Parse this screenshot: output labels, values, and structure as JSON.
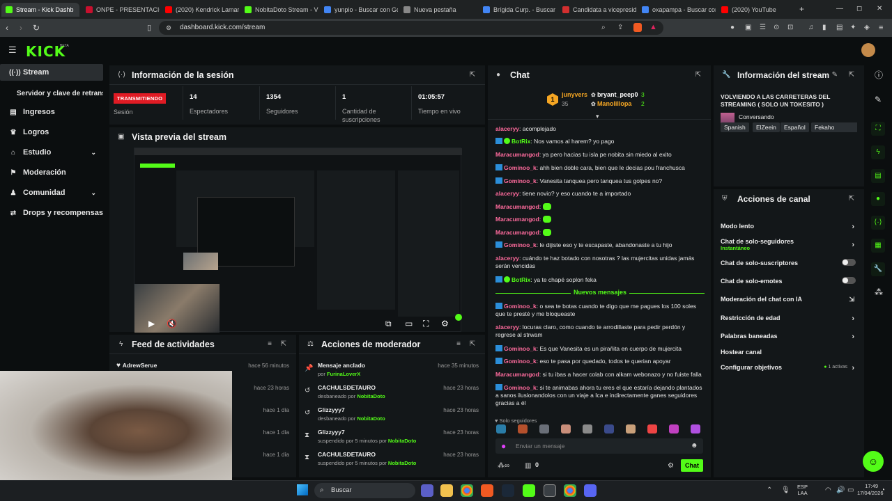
{
  "browser": {
    "tabs": [
      {
        "label": "Stream - Kick Dashb",
        "color": "#53fc18",
        "active": true
      },
      {
        "label": "ONPE - PRESENTACIÓ",
        "color": "#c8102e"
      },
      {
        "label": "(2020) Kendrick Lamar",
        "color": "#ff0000"
      },
      {
        "label": "NobitaDoto Stream - V",
        "color": "#53fc18"
      },
      {
        "label": "yunpio - Buscar con Go",
        "color": "#4285f4"
      },
      {
        "label": "Nueva pestaña",
        "color": "#888888"
      },
      {
        "label": "Brígida Curp. - Buscar",
        "color": "#4285f4"
      },
      {
        "label": "Candidata a vicepresid",
        "color": "#d32f2f"
      },
      {
        "label": "oxapampa - Buscar con",
        "color": "#4285f4"
      },
      {
        "label": "(2020) YouTube",
        "color": "#ff0000"
      }
    ],
    "url": "dashboard.kick.com/stream"
  },
  "app": {
    "logo": "KICK",
    "beta": "BETA"
  },
  "sidebar": {
    "items": [
      {
        "label": "Stream",
        "icon": "broadcast-icon",
        "active": true
      },
      {
        "label": "Servidor y clave de retransmi",
        "sub": true
      },
      {
        "label": "Ingresos",
        "icon": "revenue-icon"
      },
      {
        "label": "Logros",
        "icon": "trophy-icon"
      },
      {
        "label": "Estudio",
        "icon": "studio-icon",
        "chevron": true
      },
      {
        "label": "Moderación",
        "icon": "moderation-icon"
      },
      {
        "label": "Comunidad",
        "icon": "community-icon",
        "chevron": true
      },
      {
        "label": "Drops y recompensas",
        "icon": "gift-icon"
      }
    ]
  },
  "session": {
    "title": "Información de la sesión",
    "status": "TRANSMITIENDO",
    "status_label": "Sesión",
    "stats": [
      {
        "value": "14",
        "label": "Espectadores"
      },
      {
        "value": "1354",
        "label": "Seguidores"
      },
      {
        "value": "1",
        "label": "Cantidad de suscripciones"
      },
      {
        "value": "01:05:57",
        "label": "Tiempo en vivo"
      }
    ]
  },
  "preview": {
    "title": "Vista previa del stream"
  },
  "feed": {
    "title": "Feed de actividades",
    "rows": [
      {
        "name": "AdrewSerue",
        "time": "hace 56 minutos"
      },
      {
        "name": "",
        "time": "hace 23 horas"
      },
      {
        "name": "",
        "time": "hace 1 día"
      },
      {
        "name": "",
        "time": "hace 1 día"
      },
      {
        "name": "",
        "time": "hace 1 día"
      }
    ]
  },
  "mod": {
    "title": "Acciones de moderador",
    "rows": [
      {
        "name": "Mensaje anclado",
        "prefix": "por",
        "by": "FurinaLoverX",
        "time": "hace 35 minutos",
        "icon": "pin-icon"
      },
      {
        "name": "CACHULSDETAURO",
        "prefix": "desbaneado por",
        "by": "NobitaDoto",
        "time": "hace 23 horas",
        "icon": "undo-icon"
      },
      {
        "name": "Glizzyyy7",
        "prefix": "desbaneado por",
        "by": "NobitaDoto",
        "time": "hace 23 horas",
        "icon": "undo-icon"
      },
      {
        "name": "Glizzyyy7",
        "prefix": "suspendido por 5 minutos por",
        "by": "NobitaDoto",
        "time": "hace 23 horas",
        "icon": "hourglass-icon"
      },
      {
        "name": "CACHULSDETAURO",
        "prefix": "suspendido por 5 minutos por",
        "by": "NobitaDoto",
        "time": "hace 23 horas",
        "icon": "hourglass-icon"
      }
    ]
  },
  "chat": {
    "title": "Chat",
    "top": [
      {
        "name": "junyvers",
        "count": "35",
        "color": "#f5a623"
      },
      {
        "name": "bryant_peep0",
        "count": "3",
        "color": "#ffffff"
      },
      {
        "name": "Manolillopa",
        "count": "2",
        "color": "#f5a623"
      }
    ],
    "messages": [
      {
        "user": "alaceryy",
        "color": "#ff6b9d",
        "text": ": acomplejado"
      },
      {
        "user": "BotRix",
        "color": "#53fc18",
        "text": ": Nos vamos al harem? yo pago",
        "badges": true
      },
      {
        "user": "Maracumangod",
        "color": "#ff6b9d",
        "text": ": ya pero hacias tu isla pe nobita sin miedo al exito"
      },
      {
        "user": "Gominoo_k",
        "color": "#ff6b9d",
        "text": ": ahh bien doble cara, bien que le decias pou franchusca",
        "badge": true
      },
      {
        "user": "Gominoo_k",
        "color": "#ff6b9d",
        "text": ": Vanesita tanquea pero tanquea tus golpes no?",
        "badge": true
      },
      {
        "user": "alaceryy",
        "color": "#ff6b9d",
        "text": ": tiene novio? y eso cuando te a importado"
      },
      {
        "user": "Maracumangod",
        "color": "#ff6b9d",
        "text": ":",
        "emote": true
      },
      {
        "user": "Maracumangod",
        "color": "#ff6b9d",
        "text": ":",
        "emote": true
      },
      {
        "user": "Maracumangod",
        "color": "#ff6b9d",
        "text": ":",
        "emote": true
      },
      {
        "user": "Gominoo_k",
        "color": "#ff6b9d",
        "text": ": le dijiste eso y te escapaste, abandonaste a tu hijo",
        "badge": true
      },
      {
        "user": "alaceryy",
        "color": "#ff6b9d",
        "text": ": cuándo te haz botado con nosotras ? las mujercitas unidas jamás serán vencidas"
      },
      {
        "user": "BotRix",
        "color": "#53fc18",
        "text": ": ya te chapé soplon feka",
        "badges": true
      }
    ],
    "new_label": "Nuevos mensajes",
    "new_messages": [
      {
        "user": "Gominoo_k",
        "color": "#ff6b9d",
        "text": ": o sea te botas cuando te digo que me pagues los 100 soles que te presté y me bloqueaste",
        "badge": true
      },
      {
        "user": "alaceryy",
        "color": "#ff6b9d",
        "text": ": locuras claro, como cuando te arrodillaste para pedir perdón y regrese al strwam"
      },
      {
        "user": "Gominoo_k",
        "color": "#ff6b9d",
        "text": ": Es que Vanesita es un piraňita en cuerpo de mujercita",
        "badge": true
      },
      {
        "user": "Gominoo_k",
        "color": "#ff6b9d",
        "text": ": eso te pasa por quedado, todos te querian apoyar",
        "badge": true
      },
      {
        "user": "Maracumangod",
        "color": "#ff6b9d",
        "text": ": si tu ibas a hacer colab con alkam webonazo y no fuiste falla"
      },
      {
        "user": "Gominoo_k",
        "color": "#ff6b9d",
        "text": ": si te animabas ahora tu eres el que estaría dejando plantados a sanos ilusionandolos con un viaje a Ica e indirectamente ganes seguidores gracias a él",
        "badge": true
      }
    ],
    "mode": "Solo seguidores",
    "placeholder": "Enviar un mensaje",
    "points": "0",
    "send": "Chat"
  },
  "stream_info": {
    "title": "Información del stream",
    "stream_title": "VOLVIENDO A LAS CARRETERAS DEL STREAMING ( SOLO UN TOKESITO )",
    "category": "Conversando",
    "tags": [
      "Spanish",
      "ElZeein",
      "Español",
      "Fekaho"
    ]
  },
  "channel_actions": {
    "title": "Acciones de canal",
    "items": [
      {
        "label": "Modo lento",
        "type": "arrow"
      },
      {
        "label": "Chat de solo-seguidores",
        "sub": "Instantáneo",
        "type": "arrow"
      },
      {
        "label": "Chat de solo-suscriptores",
        "type": "toggle"
      },
      {
        "label": "Chat de solo-emotes",
        "type": "toggle"
      },
      {
        "label": "Moderación del chat con IA",
        "type": "external"
      },
      {
        "label": "Restricción de edad",
        "type": "arrow"
      },
      {
        "label": "Palabras baneadas",
        "type": "arrow"
      },
      {
        "label": "Hostear canal",
        "type": "none"
      },
      {
        "label": "Configurar objetivos",
        "extra": "1 activas",
        "type": "arrow"
      }
    ]
  },
  "taskbar": {
    "search": "Buscar",
    "lang": "ESP",
    "lang2": "LAA",
    "time": "17:49",
    "date": "17/04/2026"
  },
  "colors": {
    "accent": "#53fc18",
    "live": "#e01b24",
    "panel": "#131719",
    "bg": "#0b0e0f"
  }
}
